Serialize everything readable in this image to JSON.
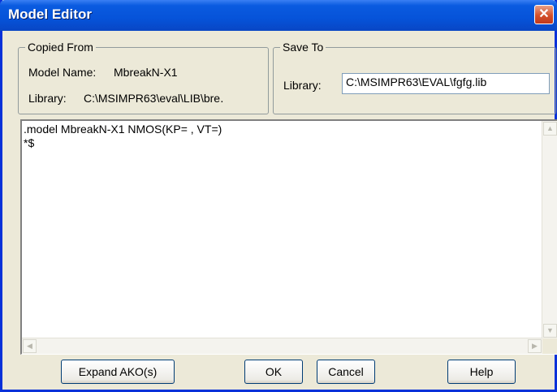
{
  "window": {
    "title": "Model Editor",
    "close_label": "✕"
  },
  "copied_from": {
    "legend": "Copied From",
    "model_name_label": "Model Name:",
    "model_name_value": "MbreakN-X1",
    "library_label": "Library:",
    "library_value": "C:\\MSIMPR63\\eval\\LIB\\bre․"
  },
  "save_to": {
    "legend": "Save To",
    "library_label": "Library:",
    "library_value": "C:\\MSIMPR63\\EVAL\\fgfg.lib"
  },
  "editor": {
    "text": ".model MbreakN-X1 NMOS(KP= , VT=)\n*$"
  },
  "buttons": {
    "expand": "Expand AKO(s)",
    "ok": "OK",
    "cancel": "Cancel",
    "help": "Help"
  }
}
